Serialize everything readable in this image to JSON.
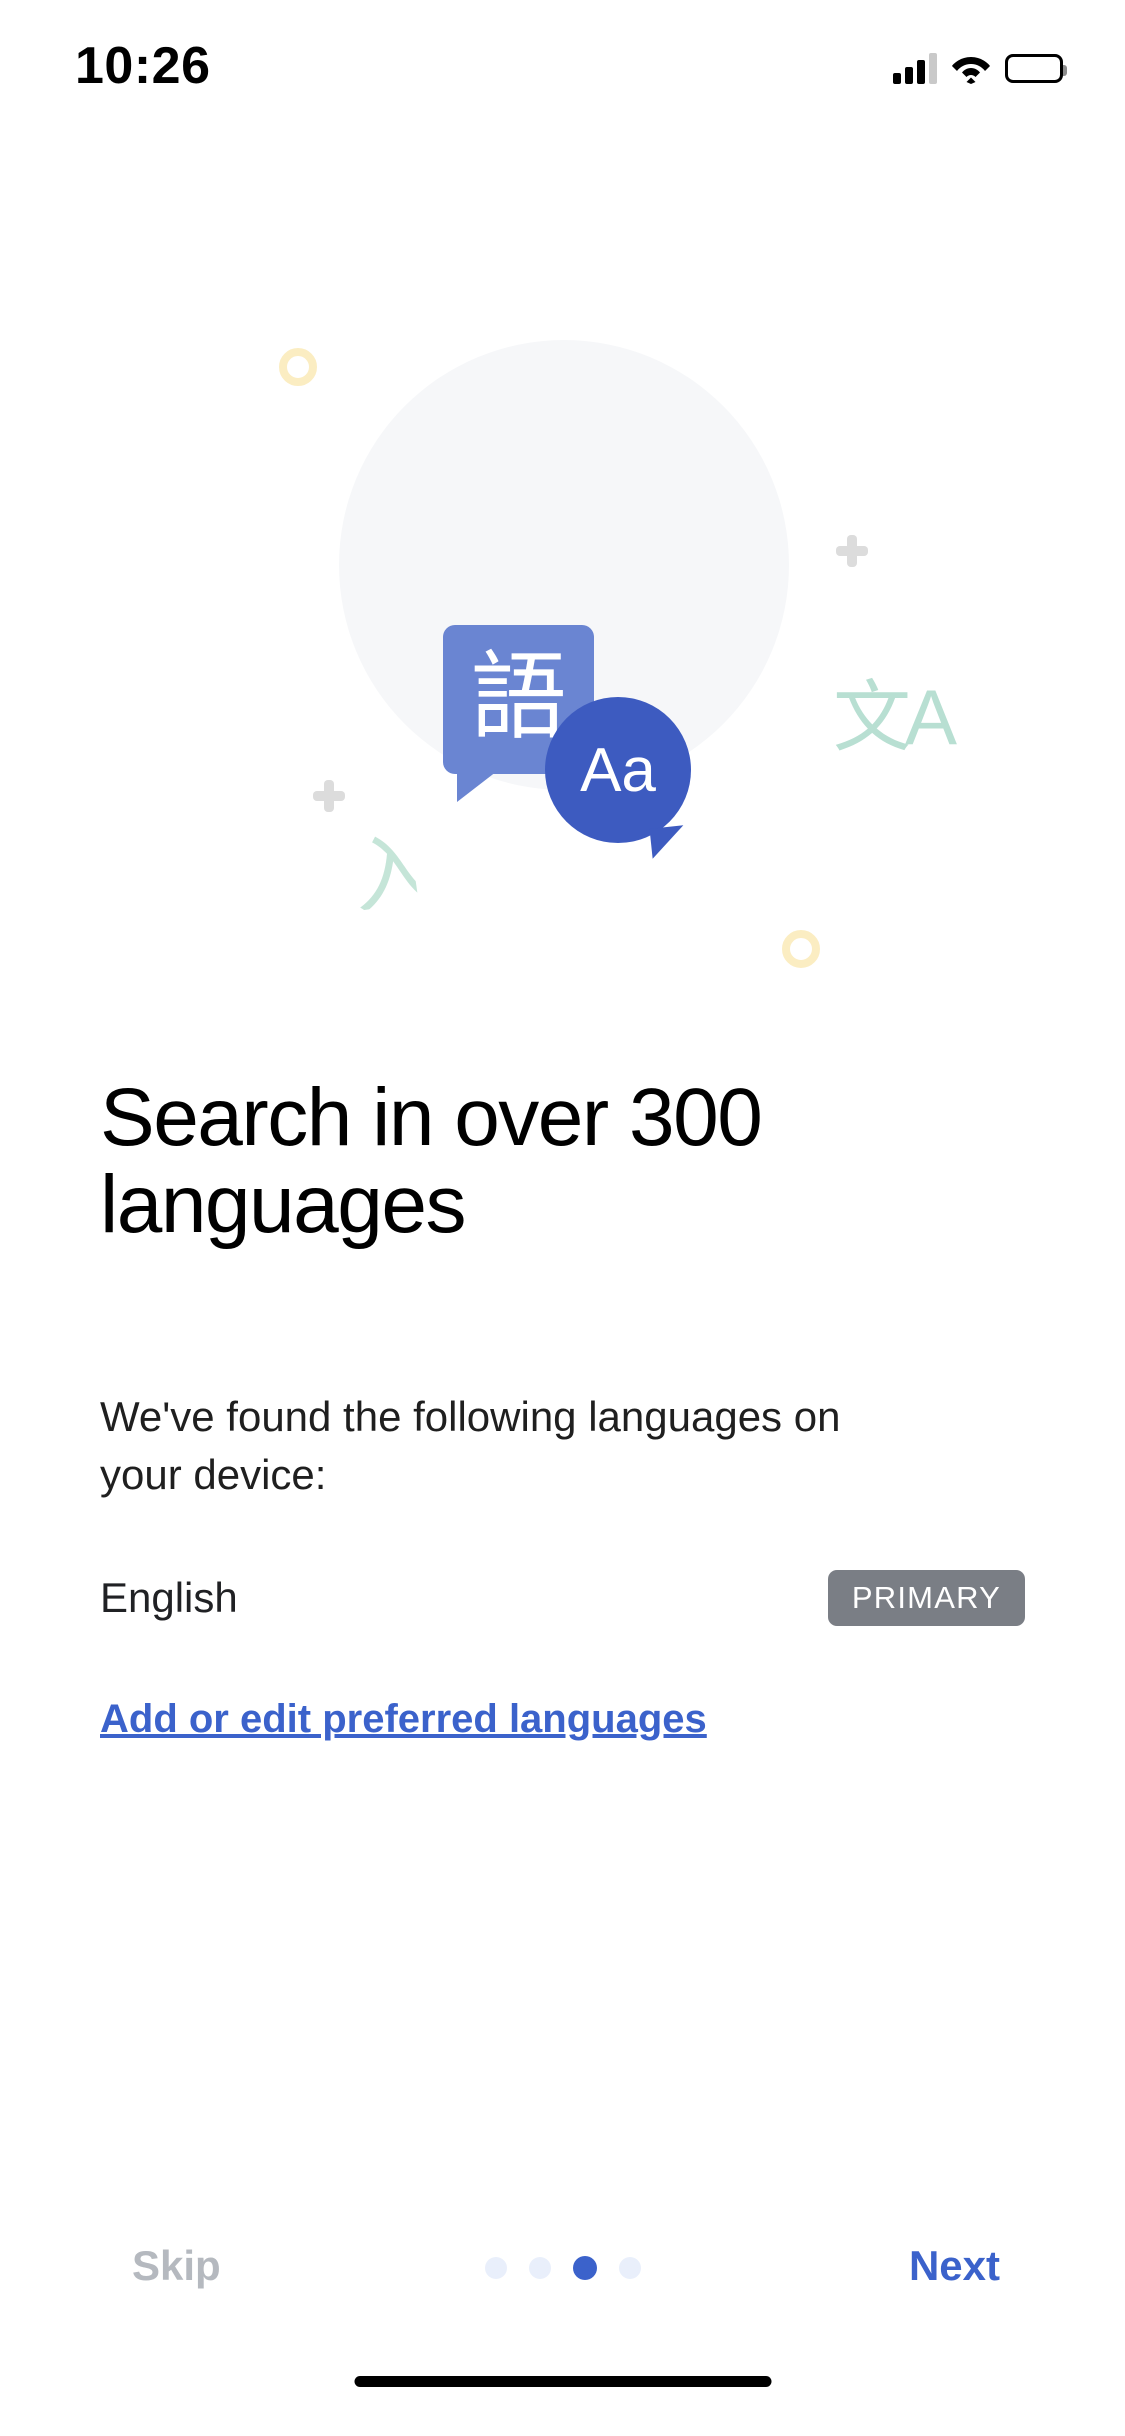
{
  "status_bar": {
    "time": "10:26",
    "cellular_icon": "signal-bars-icon",
    "wifi_icon": "wifi-icon",
    "battery_icon": "battery-full-icon"
  },
  "hero": {
    "speech_bubble_square_text": "語",
    "speech_bubble_round_text": "Aa",
    "decor_translate_glyph": "文A",
    "decor_kanji_glyph": "入",
    "colors": {
      "circle_bg": "#f6f7f9",
      "bubble_square": "#6a85d2",
      "bubble_round": "#3d5bc0",
      "ring_yellow": "#fbedc2",
      "plus_gray": "#dcdcdc",
      "glyph_green": "#b8dfd2"
    }
  },
  "main": {
    "headline": "Search in over 300 languages",
    "subtext": "We've found the following languages on your device:",
    "languages": [
      {
        "name": "English",
        "badge": "PRIMARY"
      }
    ],
    "edit_link": "Add or edit preferred languages"
  },
  "footer": {
    "skip_label": "Skip",
    "next_label": "Next",
    "page_dots": {
      "total": 4,
      "active_index": 2
    },
    "active_color": "#3b62cb",
    "inactive_color": "#e9effb"
  }
}
